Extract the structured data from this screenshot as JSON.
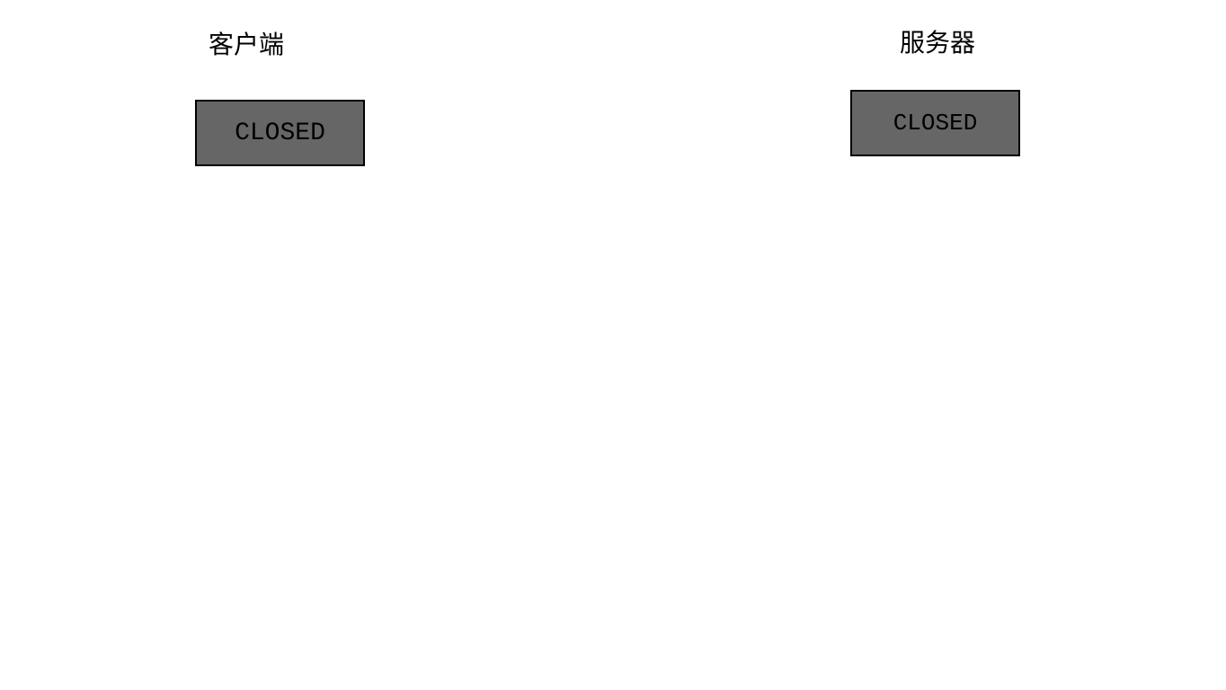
{
  "client": {
    "title": "客户端",
    "state": "CLOSED"
  },
  "server": {
    "title": "服务器",
    "state": "CLOSED"
  }
}
